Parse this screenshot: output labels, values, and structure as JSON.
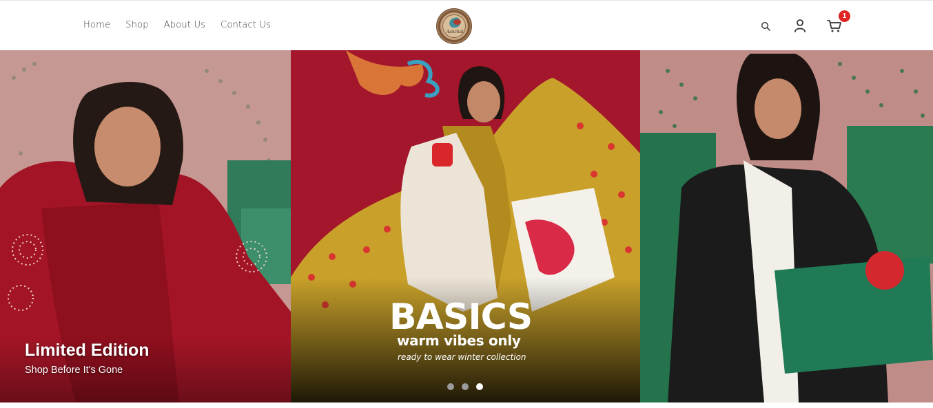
{
  "nav": {
    "items": [
      {
        "label": "Home"
      },
      {
        "label": "Shop"
      },
      {
        "label": "About Us"
      },
      {
        "label": "Contact Us"
      }
    ]
  },
  "logo": {
    "text": "Aanchal"
  },
  "header_icons": {
    "search": "search-icon",
    "account": "user-icon",
    "cart": "cart-icon",
    "cart_count": "1",
    "badge_color": "#e02424"
  },
  "slides": [
    {
      "title": "Limited Edition",
      "subtitle": "Shop Before It's Gone"
    },
    {
      "headline": "BASICS",
      "tagline": "warm vibes only",
      "subline": "ready to wear winter collection"
    },
    {}
  ],
  "carousel": {
    "dot_count": 3,
    "active_dot": 3,
    "next_icon": "chevron-right-icon"
  }
}
